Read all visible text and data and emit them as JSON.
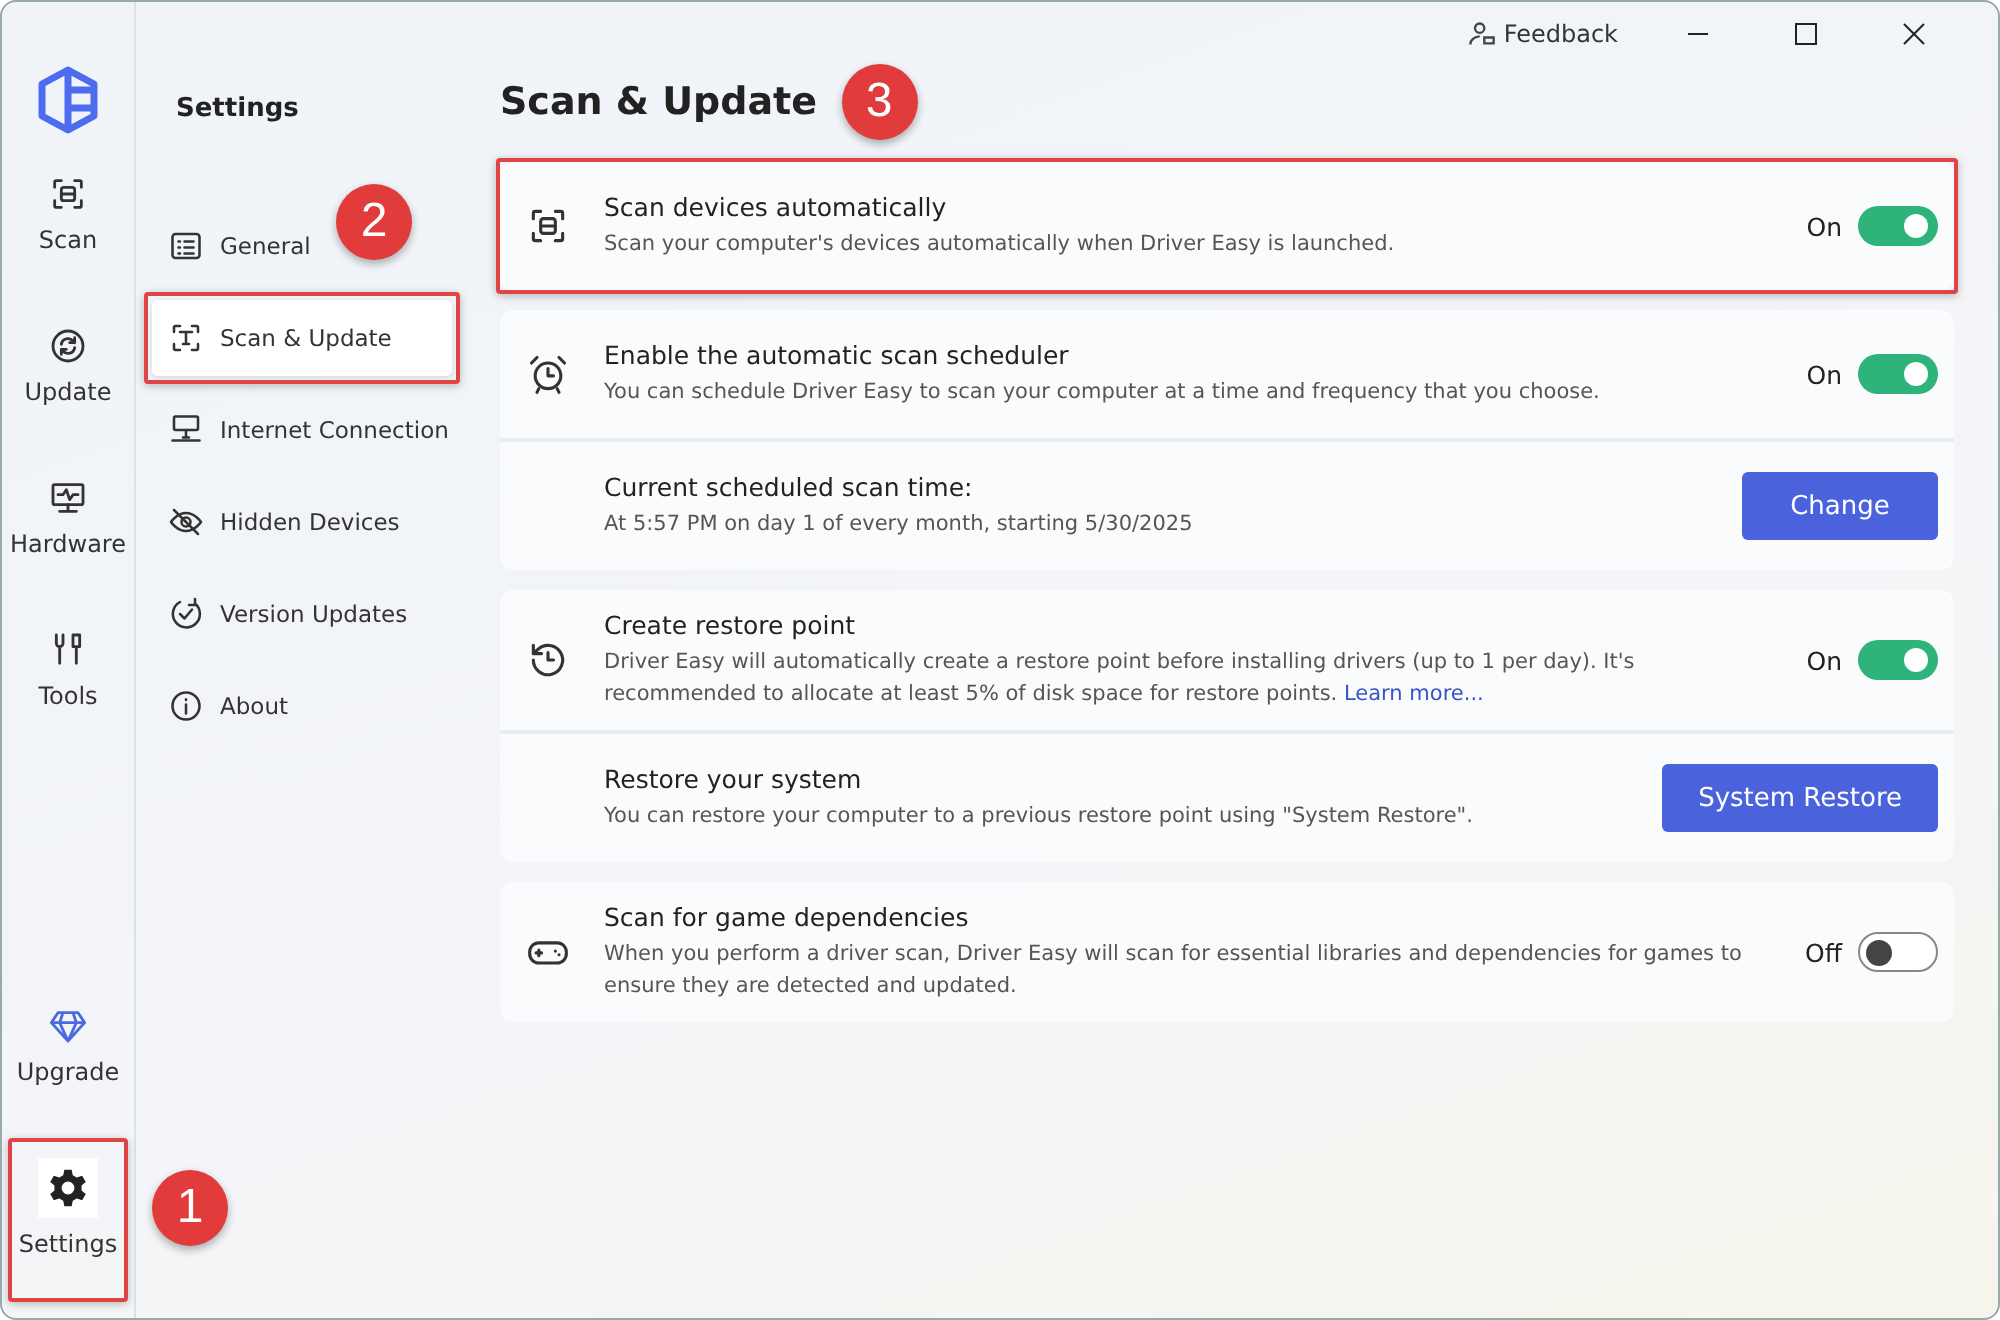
{
  "title_bar": {
    "feedback": "Feedback"
  },
  "nav": {
    "top_items": [
      {
        "label": "Scan",
        "selected": false,
        "highlighted": false
      },
      {
        "label": "Update",
        "selected": false,
        "highlighted": false
      },
      {
        "label": "Hardware",
        "selected": false,
        "highlighted": false
      },
      {
        "label": "Tools",
        "selected": false,
        "highlighted": false
      }
    ],
    "bottom_items": [
      {
        "label": "Upgrade",
        "selected": false,
        "highlighted": false
      },
      {
        "label": "Settings",
        "selected": true,
        "highlighted": true,
        "callout": "1"
      }
    ]
  },
  "settings_menu": {
    "title": "Settings",
    "items": [
      {
        "label": "General",
        "selected": false,
        "highlighted": false,
        "callout": "2"
      },
      {
        "label": "Scan & Update",
        "selected": true,
        "highlighted": true
      },
      {
        "label": "Internet Connection",
        "selected": false,
        "highlighted": false
      },
      {
        "label": "Hidden Devices",
        "selected": false,
        "highlighted": false
      },
      {
        "label": "Version Updates",
        "selected": false,
        "highlighted": false
      },
      {
        "label": "About",
        "selected": false,
        "highlighted": false
      }
    ]
  },
  "page": {
    "title": "Scan & Update",
    "callout": "3"
  },
  "groups": [
    {
      "highlighted": true,
      "rows": [
        {
          "kind": "toggle",
          "title": "Scan devices automatically",
          "description": "Scan your computer's devices automatically when Driver Easy is launched.",
          "toggle_label": "On",
          "on": true
        }
      ]
    },
    {
      "highlighted": false,
      "rows": [
        {
          "kind": "toggle",
          "title": "Enable the automatic scan scheduler",
          "description": "You can schedule Driver Easy to scan your computer at a time and frequency that you choose.",
          "toggle_label": "On",
          "on": true
        },
        {
          "kind": "button",
          "title": "Current scheduled scan time:",
          "description": "At 5:57 PM on day 1 of every month, starting 5/30/2025",
          "button": "Change"
        }
      ]
    },
    {
      "highlighted": false,
      "rows": [
        {
          "kind": "toggle",
          "title": "Create restore point",
          "description": "Driver Easy will automatically create a restore point before installing drivers (up to 1 per day). It's recommended to allocate at least 5% of disk space for restore points.",
          "link": "Learn more...",
          "toggle_label": "On",
          "on": true
        },
        {
          "kind": "button",
          "title": "Restore your system",
          "description": "You can restore your computer to a previous restore point using \"System Restore\".",
          "button": "System Restore"
        }
      ]
    },
    {
      "highlighted": false,
      "rows": [
        {
          "kind": "toggle",
          "title": "Scan for game dependencies",
          "description": "When you perform a driver scan, Driver Easy will scan for essential libraries and dependencies for games to ensure they are detected and updated.",
          "toggle_label": "Off",
          "on": false
        }
      ]
    }
  ]
}
